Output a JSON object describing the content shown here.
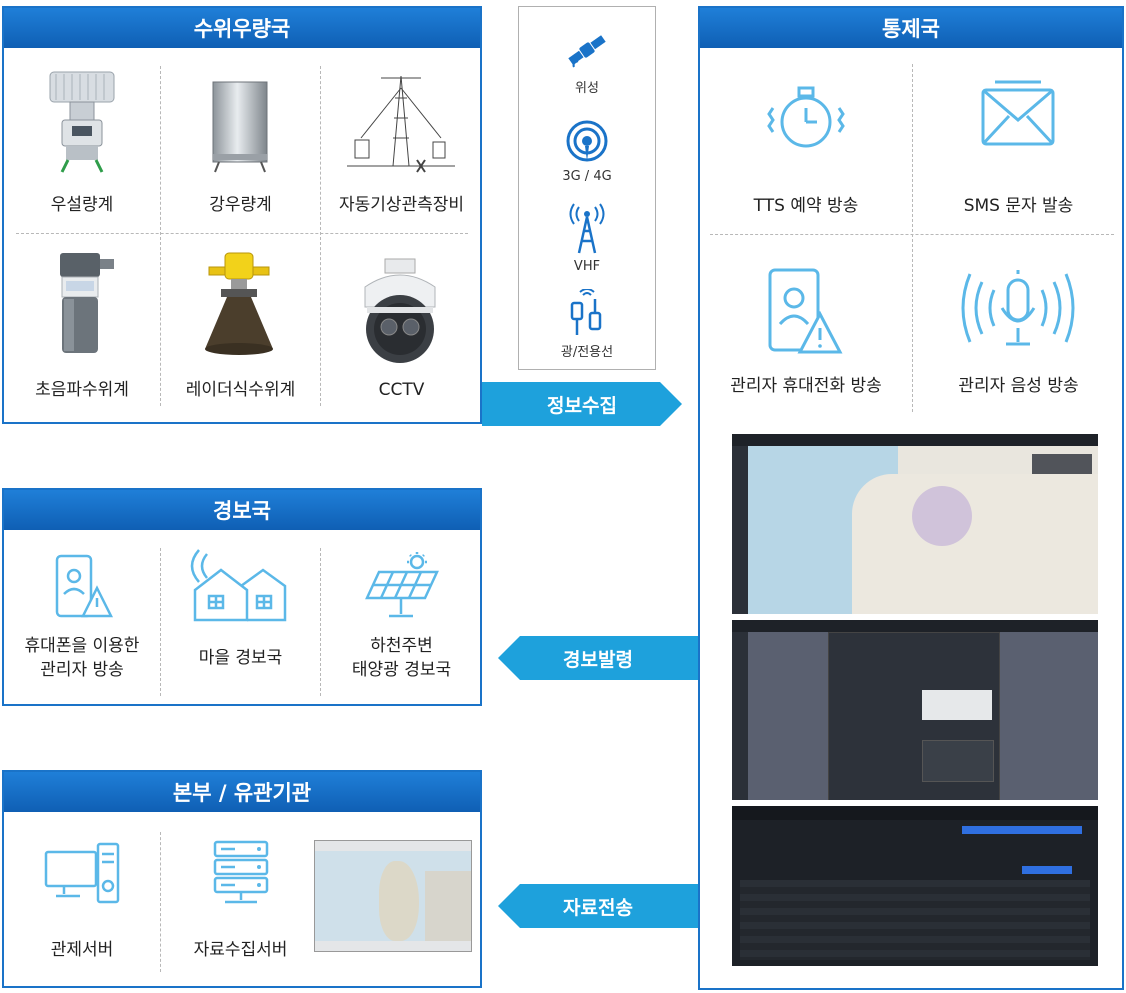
{
  "water_station": {
    "title": "수위우량국",
    "items": [
      "우설량계",
      "강우량계",
      "자동기상관측장비",
      "초음파수위계",
      "레이더식수위계",
      "CCTV"
    ]
  },
  "comm": {
    "items": [
      "위성",
      "3G / 4G",
      "VHF",
      "광/전용선"
    ]
  },
  "control": {
    "title": "통제국",
    "items": [
      "TTS 예약 방송",
      "SMS 문자 발송",
      "관리자 휴대전화 방송",
      "관리자 음성 방송"
    ]
  },
  "warning_station": {
    "title": "경보국",
    "items": [
      "휴대폰을 이용한\n관리자 방송",
      "마을 경보국",
      "하천주변\n태양광 경보국"
    ]
  },
  "hq": {
    "title": "본부 / 유관기관",
    "items": [
      "관제서버",
      "자료수집서버"
    ]
  },
  "arrows": {
    "collect": "정보수집",
    "alert": "경보발령",
    "transfer": "자료전송"
  },
  "colors": {
    "primary": "#1a73c8",
    "arrow": "#1ea1dc",
    "icon": "#5bb8e8"
  }
}
